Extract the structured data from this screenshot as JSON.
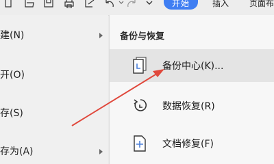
{
  "toolbar": {
    "tabs": [
      "开始",
      "插入",
      "页面布"
    ]
  },
  "left_menu": {
    "items": [
      {
        "label": "建(N)",
        "has_submenu": true
      },
      {
        "label": "开(O)",
        "has_submenu": false
      },
      {
        "label": "存(S)",
        "has_submenu": false
      },
      {
        "label": "存为(A)",
        "has_submenu": true
      }
    ]
  },
  "submenu": {
    "title": "备份与恢复",
    "items": [
      {
        "label": "备份中心(K)...",
        "icon": "backup-center-icon"
      },
      {
        "label": "数据恢复(R)",
        "icon": "data-recovery-icon"
      },
      {
        "label": "文档修复(F)",
        "icon": "document-repair-icon"
      }
    ]
  },
  "colors": {
    "accent": "#3f7ef2",
    "arrow": "#e0483c"
  }
}
